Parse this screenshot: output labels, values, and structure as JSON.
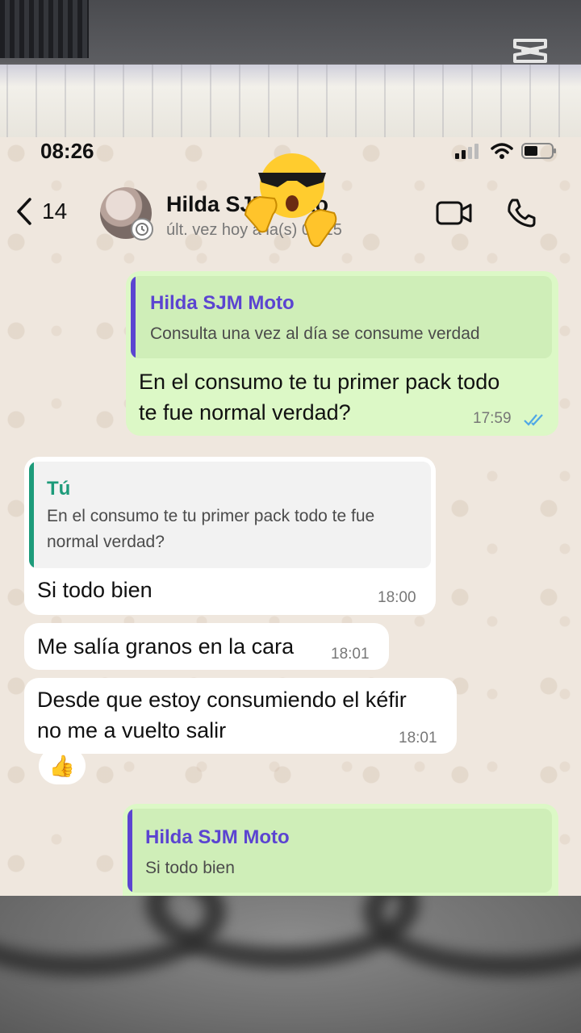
{
  "status_bar": {
    "time": "08:26"
  },
  "header": {
    "back_count": "14",
    "contact_name": "Hilda SJM Moto",
    "last_seen": "últ. vez hoy a la(s) 08:15"
  },
  "messages": [
    {
      "direction": "outgoing",
      "quote": {
        "author": "Hilda SJM Moto",
        "text": "Consulta una vez al día se consume verdad"
      },
      "text_lines": [
        "En el consumo te tu primer pack todo",
        "te fue normal verdad?"
      ],
      "time": "17:59",
      "read": true
    },
    {
      "direction": "incoming",
      "quote": {
        "author": "Tú",
        "text_lines": [
          "En el consumo te tu primer pack todo te fue",
          "normal verdad?"
        ]
      },
      "text": "Si todo bien",
      "time": "18:00"
    },
    {
      "direction": "incoming",
      "text": "Me salía granos en la cara",
      "time": "18:01"
    },
    {
      "direction": "incoming",
      "text_lines": [
        "Desde que estoy consumiendo el kéfir",
        "no me a vuelto salir"
      ],
      "time": "18:01",
      "reaction": "👍"
    },
    {
      "direction": "outgoing",
      "quote": {
        "author": "Hilda SJM Moto",
        "text": "Si todo bien"
      }
    }
  ],
  "colors": {
    "outgoing_bubble": "#dcf8c6",
    "incoming_bubble": "#ffffff",
    "quote_purple": "#5b44d1",
    "quote_green": "#1d9b7a",
    "read_ticks": "#4fa7e6"
  },
  "icons": [
    "capcut-logo",
    "back-chevron-icon",
    "video-call-icon",
    "phone-call-icon",
    "signal-icon",
    "wifi-icon",
    "battery-icon",
    "read-ticks-icon"
  ]
}
